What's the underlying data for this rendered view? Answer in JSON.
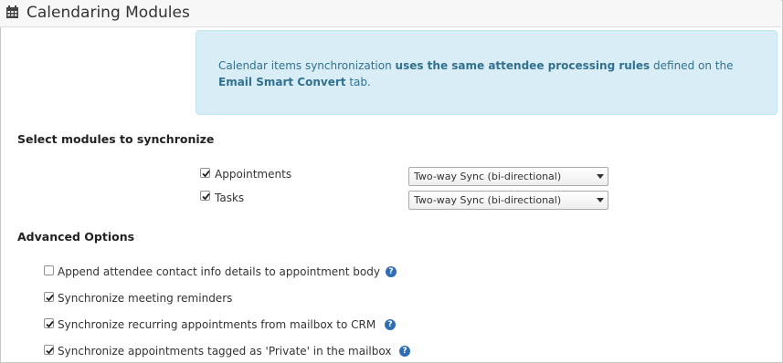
{
  "header": {
    "title": "Calendaring Modules",
    "icon": "calendar-icon"
  },
  "info": {
    "part1": "Calendar items synchronization ",
    "bold1": "uses the same attendee processing rules",
    "part2": " defined on the ",
    "bold2": "Email Smart Convert",
    "part3": " tab."
  },
  "modules": {
    "title": "Select modules to synchronize",
    "items": [
      {
        "label": "Appointments",
        "checked": true,
        "sync": "Two-way Sync (bi-directional)"
      },
      {
        "label": "Tasks",
        "checked": true,
        "sync": "Two-way Sync (bi-directional)"
      }
    ]
  },
  "advanced": {
    "title": "Advanced Options",
    "items": [
      {
        "label": "Append attendee contact info details to appointment body",
        "checked": false,
        "help": "?"
      },
      {
        "label": "Synchronize meeting reminders",
        "checked": true
      },
      {
        "label": "Synchronize recurring appointments from mailbox to CRM",
        "checked": true,
        "help": "?"
      },
      {
        "label": "Synchronize appointments tagged as 'Private' in the mailbox",
        "checked": true,
        "help": "?"
      }
    ]
  },
  "colors": {
    "accent": "#2f6db5",
    "info_bg": "#d9edf7",
    "info_text": "#31708f"
  }
}
